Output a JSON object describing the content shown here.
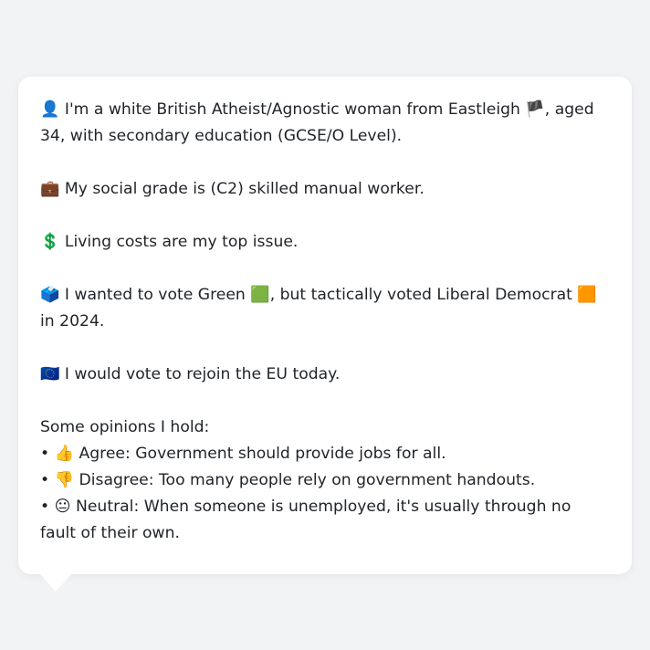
{
  "bubble": {
    "identity": {
      "icon": "👤",
      "text_a": "I'm a white British Atheist/Agnostic woman from Eastleigh ",
      "flag": "🏴",
      "text_b": ", aged 34, with secondary education (GCSE/O Level)."
    },
    "social": {
      "icon": "💼",
      "text": "My social grade is (C2) skilled manual worker."
    },
    "issue": {
      "icon": "💲",
      "text": "Living costs are my top issue."
    },
    "vote": {
      "icon": "🗳️",
      "text_a": "I wanted to vote Green ",
      "green_square": "🟩",
      "text_b": ", but tactically voted Liberal Democrat ",
      "orange_square": "🟧",
      "text_c": " in 2024."
    },
    "eu": {
      "icon": "🇪🇺",
      "text": "I would vote to rejoin the EU today."
    },
    "opinions_heading": "Some opinions I hold:",
    "opinions": [
      {
        "bullet": "•",
        "icon": "👍",
        "text": "Agree: Government should provide jobs for all."
      },
      {
        "bullet": "•",
        "icon": "👎",
        "text": "Disagree: Too many people rely on government handouts."
      },
      {
        "bullet": "•",
        "icon": "😐",
        "text": "Neutral: When someone is unemployed, it's usually through no fault of their own."
      }
    ]
  },
  "colors": {
    "background": "#f2f3f5",
    "bubble": "#ffffff",
    "text": "#1f2328"
  },
  "icons": {
    "identity": "person-icon",
    "flag": "england-flag-icon",
    "social": "briefcase-icon",
    "issue": "dollar-icon",
    "vote": "ballot-box-icon",
    "eu": "eu-flag-icon",
    "agree": "thumbs-up-icon",
    "disagree": "thumbs-down-icon",
    "neutral": "neutral-face-icon"
  }
}
